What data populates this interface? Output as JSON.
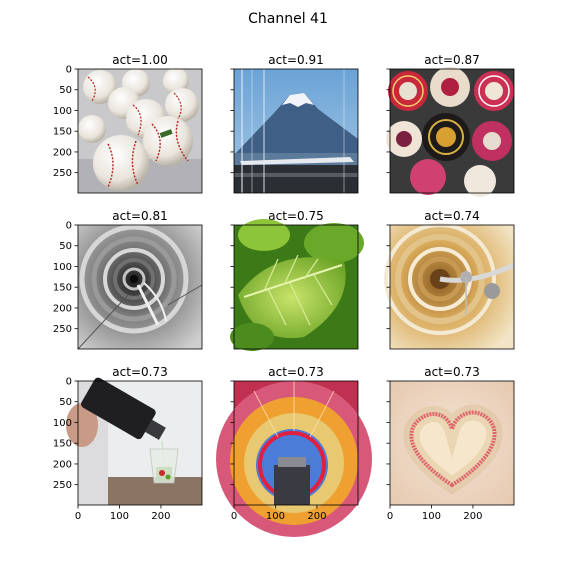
{
  "chart_data": {
    "type": "image_grid",
    "title": "Channel 41",
    "rows": 3,
    "cols": 3,
    "axis": {
      "y_ticks": [
        0,
        50,
        100,
        150,
        200,
        250
      ],
      "x_ticks": [
        0,
        100,
        200
      ],
      "xlim": [
        0,
        299
      ],
      "ylim": [
        299,
        0
      ]
    },
    "panels": [
      {
        "title": "act=1.00",
        "activation": 1.0,
        "image": "baseballs"
      },
      {
        "title": "act=0.91",
        "activation": 0.91,
        "image": "mount-fuji-bullet-train"
      },
      {
        "title": "act=0.87",
        "activation": 0.87,
        "image": "sombreros"
      },
      {
        "title": "act=0.81",
        "activation": 0.81,
        "image": "spiral-staircase-bw"
      },
      {
        "title": "act=0.75",
        "activation": 0.75,
        "image": "green-leaf"
      },
      {
        "title": "act=0.74",
        "activation": 0.74,
        "image": "spiral-staircase-color"
      },
      {
        "title": "act=0.73",
        "activation": 0.73,
        "image": "pouring-drink"
      },
      {
        "title": "act=0.73",
        "activation": 0.73,
        "image": "hot-air-balloon"
      },
      {
        "title": "act=0.73",
        "activation": 0.73,
        "image": "matchstick-heart"
      }
    ]
  }
}
